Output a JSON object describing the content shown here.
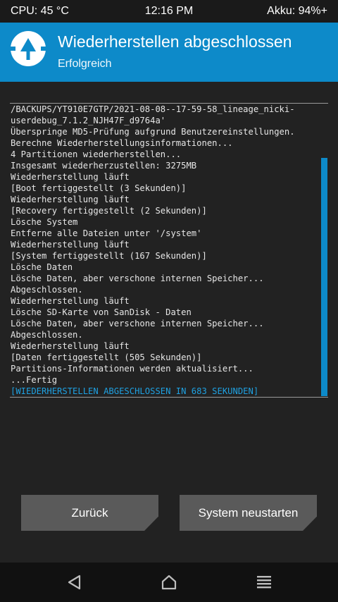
{
  "status": {
    "cpu": "CPU: 45 °C",
    "time": "12:16 PM",
    "battery": "Akku: 94%+"
  },
  "header": {
    "title": "Wiederherstellen abgeschlossen",
    "subtitle": "Erfolgreich",
    "logo_icon": "twrp-logo-icon"
  },
  "console": {
    "lines": [
      "/BACKUPS/YT910E7GTP/2021-08-08--17-59-58_lineage_nicki-",
      "userdebug_7.1.2_NJH47F_d9764a'",
      "Überspringe MD5-Prüfung aufgrund Benutzereinstellungen.",
      "Berechne Wiederherstellungsinformationen...",
      "4 Partitionen wiederherstellen...",
      "Insgesamt wiederherzustellen: 3275MB",
      "Wiederherstellung läuft",
      "[Boot fertiggestellt (3 Sekunden)]",
      "Wiederherstellung läuft",
      "[Recovery fertiggestellt (2 Sekunden)]",
      "Lösche System",
      "Entferne alle Dateien unter '/system'",
      "Wiederherstellung läuft",
      "[System fertiggestellt (167 Sekunden)]",
      "Lösche Daten",
      "Lösche Daten, aber verschone internen Speicher...",
      "Abgeschlossen.",
      "Wiederherstellung läuft",
      "Lösche SD-Karte von SanDisk - Daten",
      "Lösche Daten, aber verschone internen Speicher...",
      "Abgeschlossen.",
      "Wiederherstellung läuft",
      "[Daten fertiggestellt (505 Sekunden)]",
      "Partitions-Informationen werden aktualisiert...",
      "...Fertig"
    ],
    "final_line": "[WIEDERHERSTELLEN ABGESCHLOSSEN IN 683 SEKUNDEN]",
    "highlight_color": "#1fa0e0"
  },
  "buttons": {
    "back": "Zurück",
    "reboot": "System neustarten"
  },
  "navbar": {
    "back_icon": "back-triangle-icon",
    "home_icon": "home-icon",
    "menu_icon": "menu-icon"
  },
  "colors": {
    "accent": "#0d8ac9",
    "background": "#222222",
    "button": "#5a5a5a"
  }
}
